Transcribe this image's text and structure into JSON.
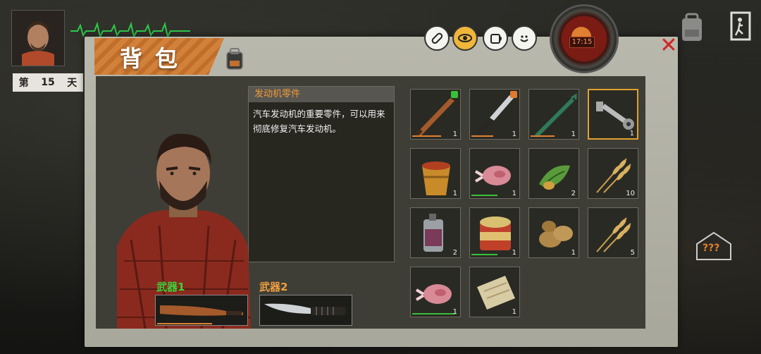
{
  "hud": {
    "day_prefix": "第",
    "day_number": "15",
    "day_suffix": "天",
    "clock_time": "17:15",
    "unknown_label": "???"
  },
  "panel": {
    "title": "背包"
  },
  "selected_item": {
    "name": "发动机零件",
    "description": "汽车发动机的重要零件，可以用来彻底修复汽车发动机。"
  },
  "weapons": {
    "slot1_label": "武器1",
    "slot2_label": "武器2",
    "slot1_item": "baseball-bat",
    "slot2_item": "hunting-knife"
  },
  "inventory": [
    {
      "item": "baseball-bat",
      "qty": "1",
      "bar_color": "#e08030",
      "bar_level": 0.6,
      "tag_color": "#3bbf3b"
    },
    {
      "item": "hunting-knife",
      "qty": "1",
      "bar_color": "#e08030",
      "bar_level": 0.45,
      "tag_color": "#e07a30"
    },
    {
      "item": "crowbar",
      "qty": "1",
      "bar_color": "#e08030",
      "bar_level": 0.5
    },
    {
      "item": "engine-parts",
      "qty": "1",
      "selected": true
    },
    {
      "item": "instant-noodles",
      "qty": "1"
    },
    {
      "item": "raw-meat",
      "qty": "1",
      "bar_color": "#3bbf3b",
      "bar_level": 0.55
    },
    {
      "item": "herbs",
      "qty": "2"
    },
    {
      "item": "wheat",
      "qty": "10"
    },
    {
      "item": "flask",
      "qty": "2"
    },
    {
      "item": "canned-food",
      "qty": "1",
      "bar_color": "#3bbf3b",
      "bar_level": 0.55
    },
    {
      "item": "potatoes",
      "qty": "1"
    },
    {
      "item": "wheat",
      "qty": "5"
    },
    {
      "item": "raw-meat",
      "qty": "1",
      "bar_color": "#3bbf3b",
      "bar_level": 0.9
    },
    {
      "item": "paper-map",
      "qty": "1"
    }
  ],
  "colors": {
    "accent": "#d2813a",
    "durability_orange": "#e08030",
    "freshness_green": "#3bbf3b",
    "selection": "#e0a030"
  }
}
